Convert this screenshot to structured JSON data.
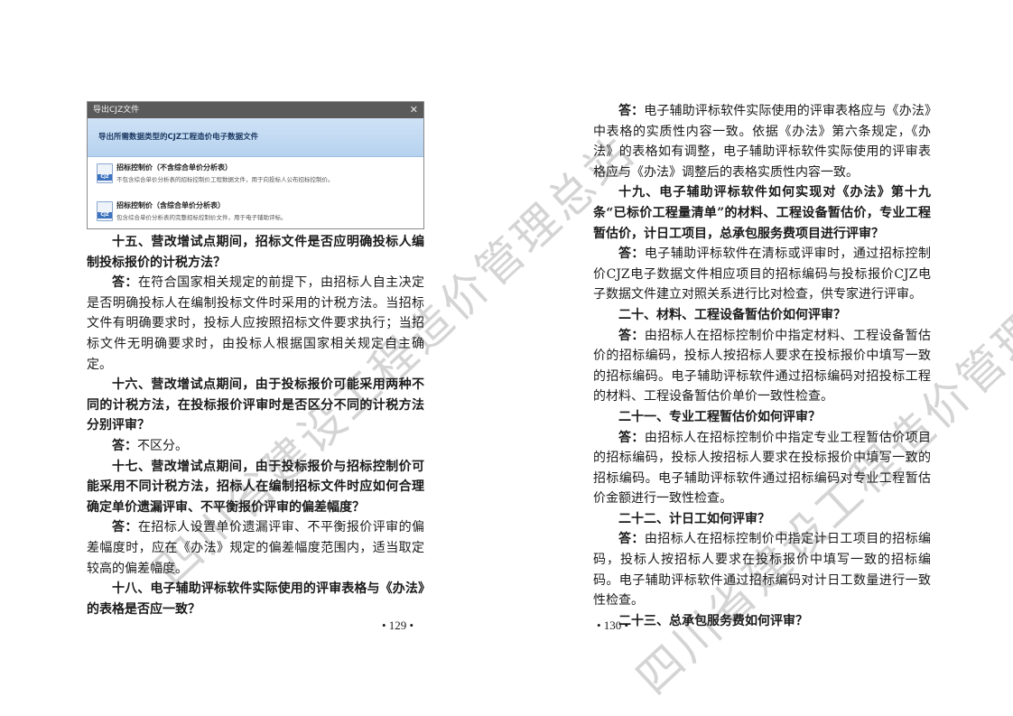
{
  "dialog": {
    "title": "导出CJZ文件",
    "close": "✕",
    "banner": "导出所需数据类型的CJZ工程造价电子数据文件",
    "options": [
      {
        "icon_label": "CJZ",
        "title": "招标控制价（不含综合单价分析表）",
        "desc": "不包含综合单价分析表的招标控制价工程数据文件，用于向投标人公布招标控制价。"
      },
      {
        "icon_label": "CJZ",
        "title": "招标控制价（含综合单价分析表）",
        "desc": "包含综合单价分析表的完整招标控制价文件，用于电子辅助评标。"
      }
    ]
  },
  "left": {
    "paragraphs": [
      {
        "type": "q",
        "text": "十五、营改增试点期间，招标文件是否应明确投标人编制投标报价的计税方法？"
      },
      {
        "type": "a",
        "label": "答：",
        "text": "在符合国家相关规定的前提下，由招标人自主决定是否明确投标人在编制投标文件时采用的计税方法。当招标文件有明确要求时，投标人应按照招标文件要求执行；当招标文件无明确要求时，由投标人根据国家相关规定自主确定。"
      },
      {
        "type": "q",
        "text": "十六、营改增试点期间，由于投标报价可能采用两种不同的计税方法，在投标报价评审时是否区分不同的计税方法分别评审？"
      },
      {
        "type": "a",
        "label": "答：",
        "text": "不区分。"
      },
      {
        "type": "q",
        "text": "十七、营改增试点期间，由于投标报价与招标控制价可能采用不同计税方法，招标人在编制招标文件时应如何合理确定单价遗漏评审、不平衡报价评审的偏差幅度？"
      },
      {
        "type": "a",
        "label": "答：",
        "text": "在招标人设置单价遗漏评审、不平衡报价评审的偏差幅度时，应在《办法》规定的偏差幅度范围内，适当取定较高的偏差幅度。"
      },
      {
        "type": "q",
        "text": "十八、电子辅助评标软件实际使用的评审表格与《办法》的表格是否应一致？"
      }
    ],
    "page_number": "• 129 •"
  },
  "right": {
    "paragraphs": [
      {
        "type": "a",
        "label": "答：",
        "text": "电子辅助评标软件实际使用的评审表格应与《办法》中表格的实质性内容一致。依据《办法》第六条规定，《办法》的表格如有调整，电子辅助评标软件实际使用的评审表格应与《办法》调整后的表格实质性内容一致。"
      },
      {
        "type": "q",
        "text": "十九、电子辅助评标软件如何实现对《办法》第十九条“已标价工程量清单”的材料、工程设备暂估价，专业工程暂估价，计日工项目，总承包服务费项目进行评审？"
      },
      {
        "type": "a",
        "label": "答：",
        "text": "电子辅助评标软件在清标或评审时，通过招标控制价CJZ电子数据文件相应项目的招标编码与投标报价CJZ电子数据文件建立对照关系进行比对检查，供专家进行评审。"
      },
      {
        "type": "h",
        "text": "二十、材料、工程设备暂估价如何评审？"
      },
      {
        "type": "a",
        "label": "答：",
        "text": "由招标人在招标控制价中指定材料、工程设备暂估价的招标编码，投标人按招标人要求在投标报价中填写一致的招标编码。电子辅助评标软件通过招标编码对招投标工程的材料、工程设备暂估价单价一致性检查。"
      },
      {
        "type": "h",
        "text": "二十一、专业工程暂估价如何评审？"
      },
      {
        "type": "a",
        "label": "答：",
        "text": "由招标人在招标控制价中指定专业工程暂估价项目的招标编码，投标人按招标人要求在投标报价中填写一致的招标编码。电子辅助评标软件通过招标编码对专业工程暂估价金额进行一致性检查。"
      },
      {
        "type": "h",
        "text": "二十二、计日工如何评审？"
      },
      {
        "type": "a",
        "label": "答：",
        "text": "由招标人在招标控制价中指定计日工项目的招标编码，投标人按招标人要求在投标报价中填写一致的招标编码。电子辅助评标软件通过招标编码对计日工数量进行一致性检查。"
      },
      {
        "type": "h",
        "text": "二十三、总承包服务费如何评审？"
      }
    ],
    "page_number": "• 130 •"
  },
  "watermarks": [
    "四川省建设工程造价管理总站",
    "四川省建设工程造价管理总站"
  ]
}
